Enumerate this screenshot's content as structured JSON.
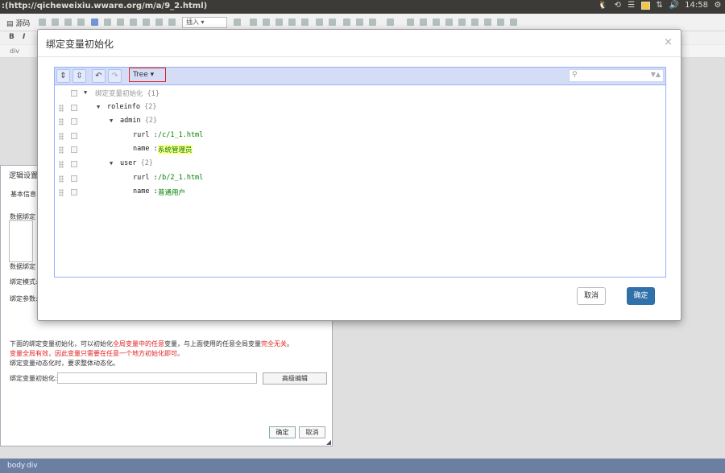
{
  "window": {
    "title": ":(http://qicheweixiu.wware.org/m/a/9_2.html)",
    "clock": "14:58"
  },
  "editor": {
    "source_label": "源码",
    "insert_label": "插入",
    "format_buttons": [
      "B",
      "I"
    ],
    "element_path_top": "div",
    "status_path": [
      "body",
      "div"
    ]
  },
  "logic_panel": {
    "header": "逻辑设置",
    "tab_basic": "基本信息",
    "label_bind_data": "数据绑定",
    "label_bind_data2": "数据绑定",
    "label_bind_mode": "绑定模式:",
    "label_bind_params": "绑定参数:",
    "note_line1_a": "下面的绑定变量初始化，可以初始化",
    "note_line1_red1": "全局变量中的任意",
    "note_line1_b": "变量，与上面使用的任意全局变量",
    "note_line1_red2": "完全无关",
    "note_line1_c": "。",
    "note_line2": "变量全局有效，因此变量只需要在任意一个地方初始化即可。",
    "note_line3": "绑定变量动态化时，要求整体动态化。",
    "init_label": "绑定变量初始化:",
    "advanced_edit": "高级编辑",
    "ok": "确定",
    "cancel": "取消"
  },
  "modal": {
    "title": "绑定变量初始化",
    "close": "×",
    "mode_label": "Tree ▾",
    "search_placeholder": "",
    "cancel": "取消",
    "ok": "确定",
    "tree": {
      "root_label": "绑定变量初始化",
      "root_count": "{1}",
      "roleinfo": {
        "key": "roleinfo",
        "count": "{2}"
      },
      "admin": {
        "key": "admin",
        "count": "{2}",
        "rurl_key": "rurl",
        "rurl_value": "/c/1_1.html",
        "name_key": "name",
        "name_value": "系统管理员"
      },
      "user": {
        "key": "user",
        "count": "{2}",
        "rurl_key": "rurl",
        "rurl_value": "/b/2_1.html",
        "name_key": "name",
        "name_value": "普通用户"
      },
      "colon": ":"
    }
  }
}
